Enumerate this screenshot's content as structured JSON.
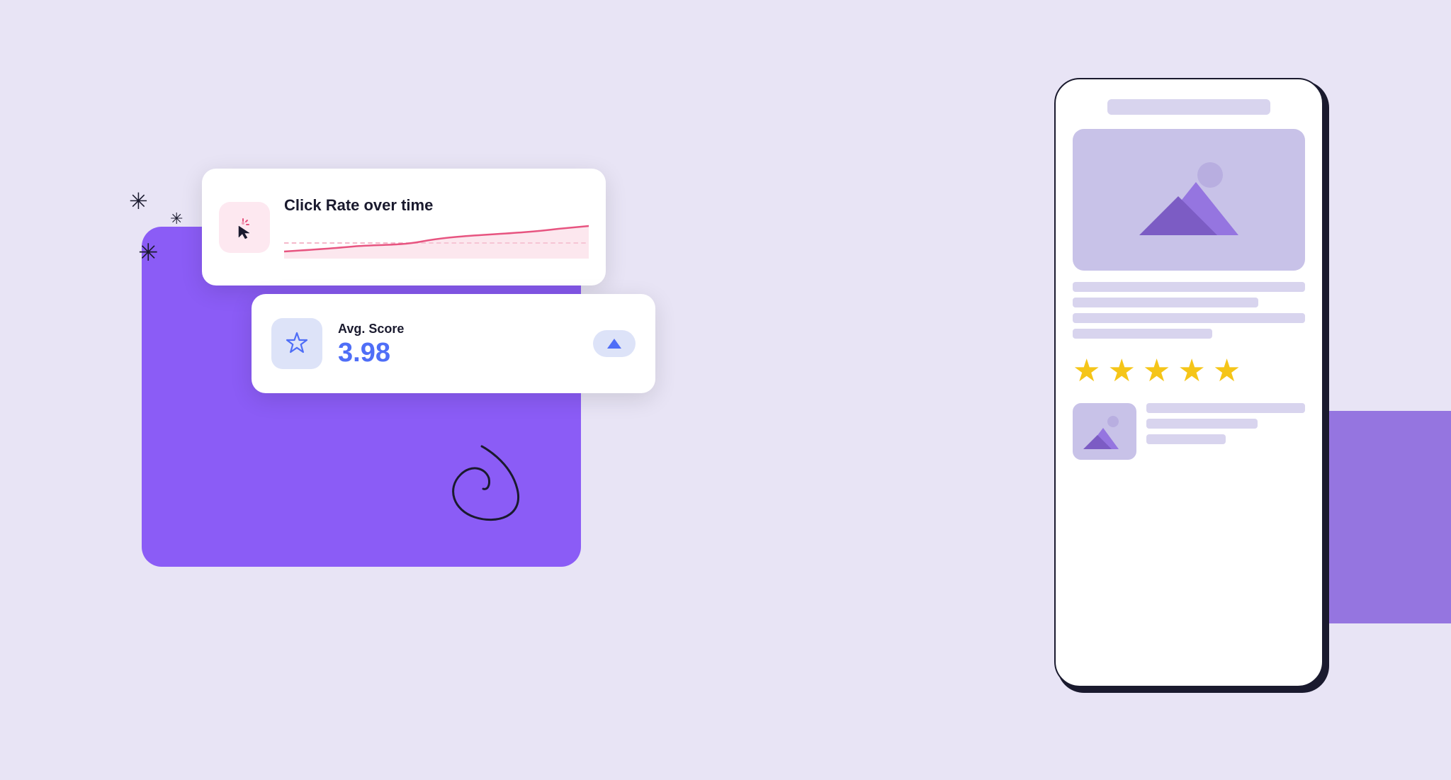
{
  "background": {
    "color": "#e8e4f5"
  },
  "click_rate_card": {
    "title": "Click Rate over time",
    "icon_label": "cursor-click-icon"
  },
  "avg_score_card": {
    "label": "Avg. Score",
    "value": "3.98",
    "up_label": "▲"
  },
  "decorations": {
    "star_symbols": [
      "✳",
      "✳",
      "✳"
    ],
    "swirl": "swirl-decoration"
  },
  "phone": {
    "stars": [
      "★",
      "★",
      "★",
      "★",
      "★"
    ]
  }
}
